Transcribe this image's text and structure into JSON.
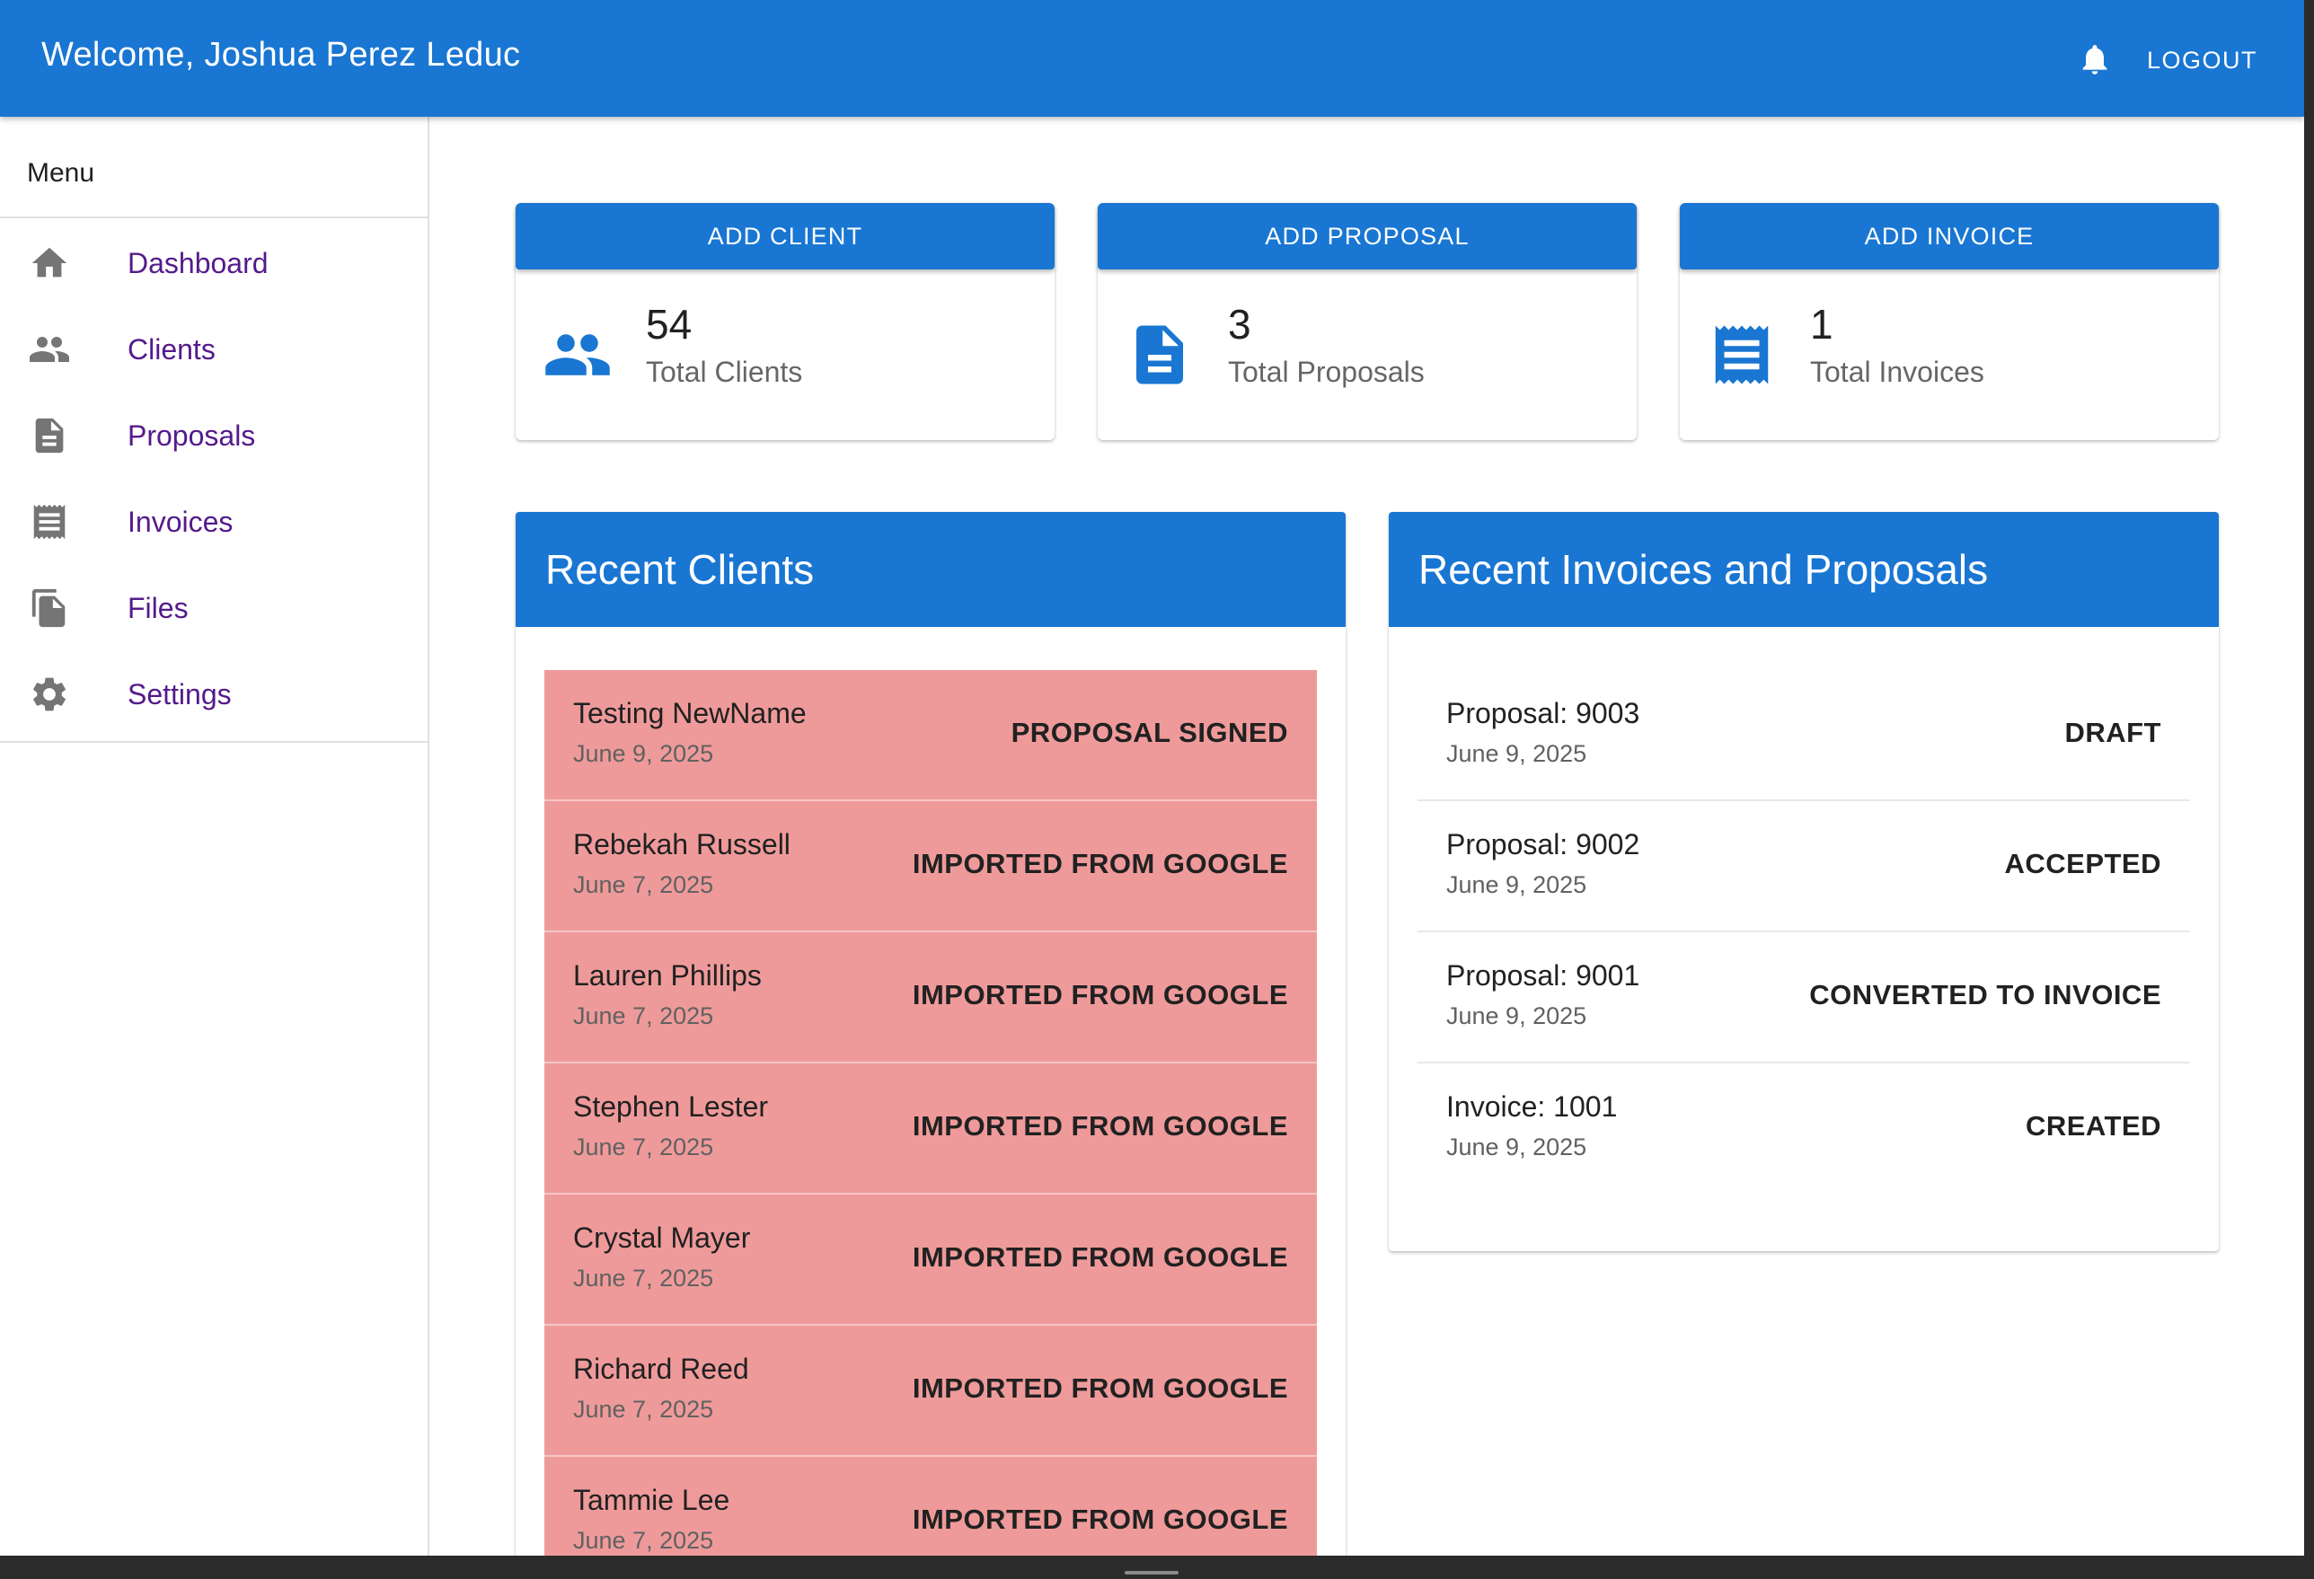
{
  "appbar": {
    "title": "Welcome, Joshua Perez Leduc",
    "logout_label": "LOGOUT",
    "bell_icon": "notifications-icon"
  },
  "sidebar": {
    "menu_title": "Menu",
    "items": [
      {
        "label": "Dashboard",
        "icon": "home-icon"
      },
      {
        "label": "Clients",
        "icon": "people-icon"
      },
      {
        "label": "Proposals",
        "icon": "document-icon"
      },
      {
        "label": "Invoices",
        "icon": "receipt-icon"
      },
      {
        "label": "Files",
        "icon": "files-icon"
      },
      {
        "label": "Settings",
        "icon": "gear-icon"
      }
    ]
  },
  "stats": [
    {
      "button": "ADD CLIENT",
      "count": "54",
      "label": "Total Clients",
      "icon": "people-icon"
    },
    {
      "button": "ADD PROPOSAL",
      "count": "3",
      "label": "Total Proposals",
      "icon": "document-icon"
    },
    {
      "button": "ADD INVOICE",
      "count": "1",
      "label": "Total Invoices",
      "icon": "receipt-icon"
    }
  ],
  "recent_clients": {
    "title": "Recent Clients",
    "rows": [
      {
        "name": "Testing NewName",
        "date": "June 9, 2025",
        "status": "PROPOSAL SIGNED"
      },
      {
        "name": "Rebekah Russell",
        "date": "June 7, 2025",
        "status": "IMPORTED FROM GOOGLE"
      },
      {
        "name": "Lauren Phillips",
        "date": "June 7, 2025",
        "status": "IMPORTED FROM GOOGLE"
      },
      {
        "name": "Stephen Lester",
        "date": "June 7, 2025",
        "status": "IMPORTED FROM GOOGLE"
      },
      {
        "name": "Crystal Mayer",
        "date": "June 7, 2025",
        "status": "IMPORTED FROM GOOGLE"
      },
      {
        "name": "Richard Reed",
        "date": "June 7, 2025",
        "status": "IMPORTED FROM GOOGLE"
      },
      {
        "name": "Tammie Lee",
        "date": "June 7, 2025",
        "status": "IMPORTED FROM GOOGLE"
      }
    ]
  },
  "recent_docs": {
    "title": "Recent Invoices and Proposals",
    "rows": [
      {
        "name": "Proposal: 9003",
        "date": "June 9, 2025",
        "status": "DRAFT"
      },
      {
        "name": "Proposal: 9002",
        "date": "June 9, 2025",
        "status": "ACCEPTED"
      },
      {
        "name": "Proposal: 9001",
        "date": "June 9, 2025",
        "status": "CONVERTED TO INVOICE"
      },
      {
        "name": "Invoice: 1001",
        "date": "June 9, 2025",
        "status": "CREATED"
      }
    ]
  },
  "colors": {
    "primary": "#1976d2",
    "client_row": "#ef9a9a",
    "nav_link": "#551a8b"
  }
}
